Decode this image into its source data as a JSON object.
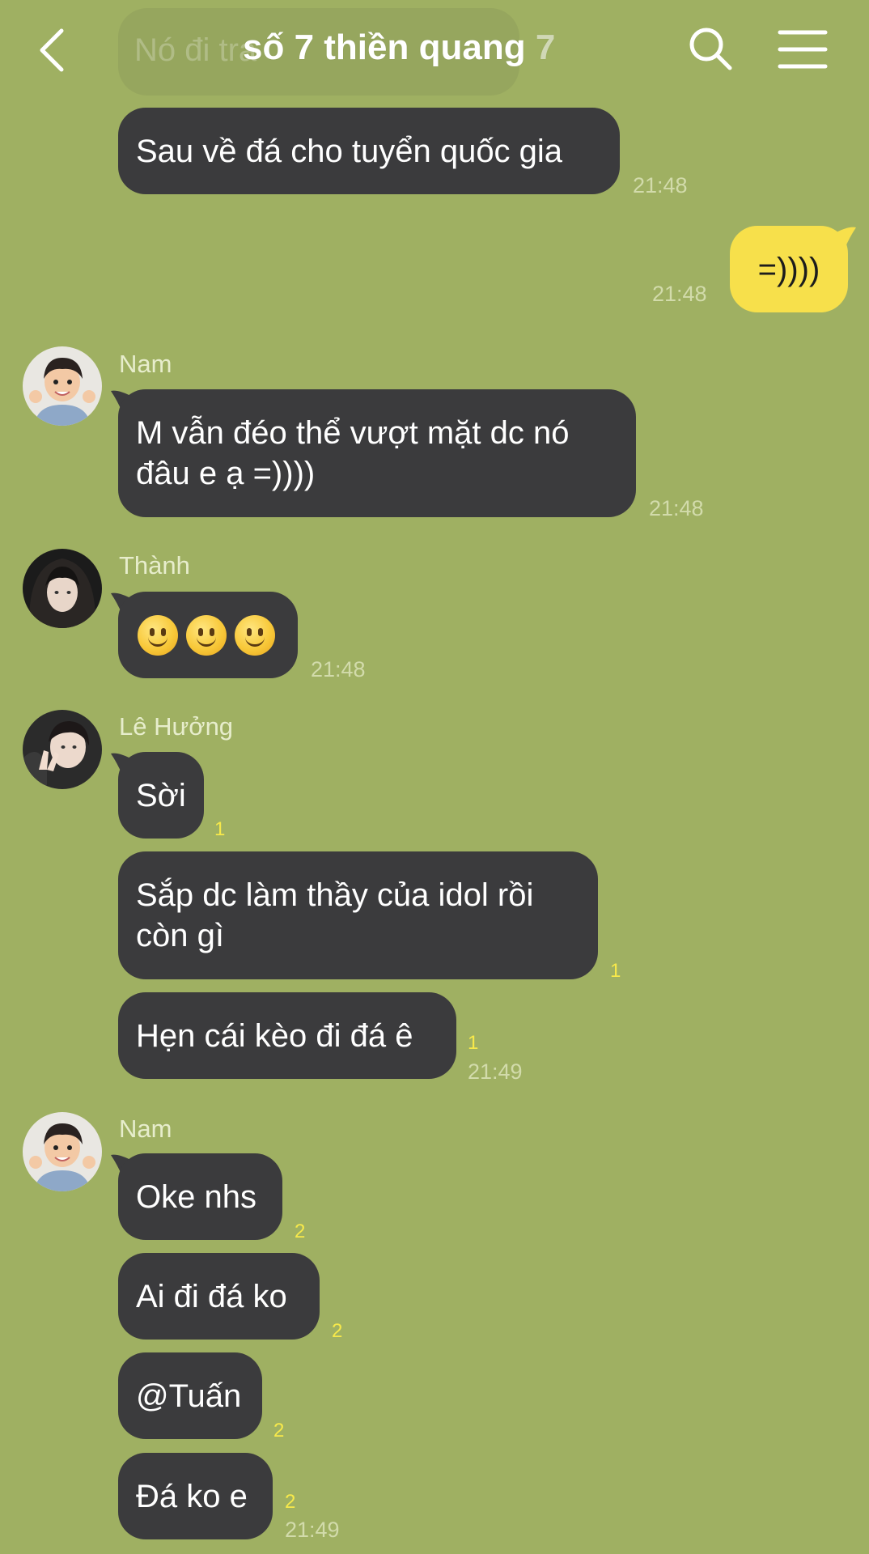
{
  "header": {
    "title_main": "số 7 thiền quang",
    "title_count": "7",
    "prev_message": "Nó đi tra"
  },
  "messages": {
    "m1": {
      "text": "Sau về đá cho tuyển quốc gia",
      "time": "21:48"
    },
    "m2": {
      "text": "=))))",
      "time": "21:48"
    },
    "g1": {
      "sender": "Nam",
      "text": "M vẫn đéo thể vượt mặt dc nó\nđâu e ạ =))))",
      "time": "21:48"
    },
    "g2": {
      "sender": "Thành",
      "emoji": "slightly-smiling-face-emoji x3",
      "time": "21:48"
    },
    "g3": {
      "sender": "Lê Hưởng",
      "m1": {
        "text": "Sời",
        "unread": "1"
      },
      "m2": {
        "text": "Sắp dc làm thầy của idol rồi\ncòn gì",
        "unread": "1"
      },
      "m3": {
        "text": "Hẹn cái kèo đi đá ê",
        "unread": "1",
        "time": "21:49"
      }
    },
    "g4": {
      "sender": "Nam",
      "m1": {
        "text": "Oke nhs",
        "unread": "2"
      },
      "m2": {
        "text": "Ai đi đá ko",
        "unread": "2"
      },
      "m3": {
        "text": "@Tuấn",
        "unread": "2"
      },
      "m4": {
        "text": "Đá ko e",
        "unread": "2",
        "time": "21:49"
      }
    }
  },
  "colors": {
    "background": "#9fb062",
    "bubble_other": "#3b3b3d",
    "bubble_mine": "#f7e04b",
    "unread": "#f7e94a"
  }
}
